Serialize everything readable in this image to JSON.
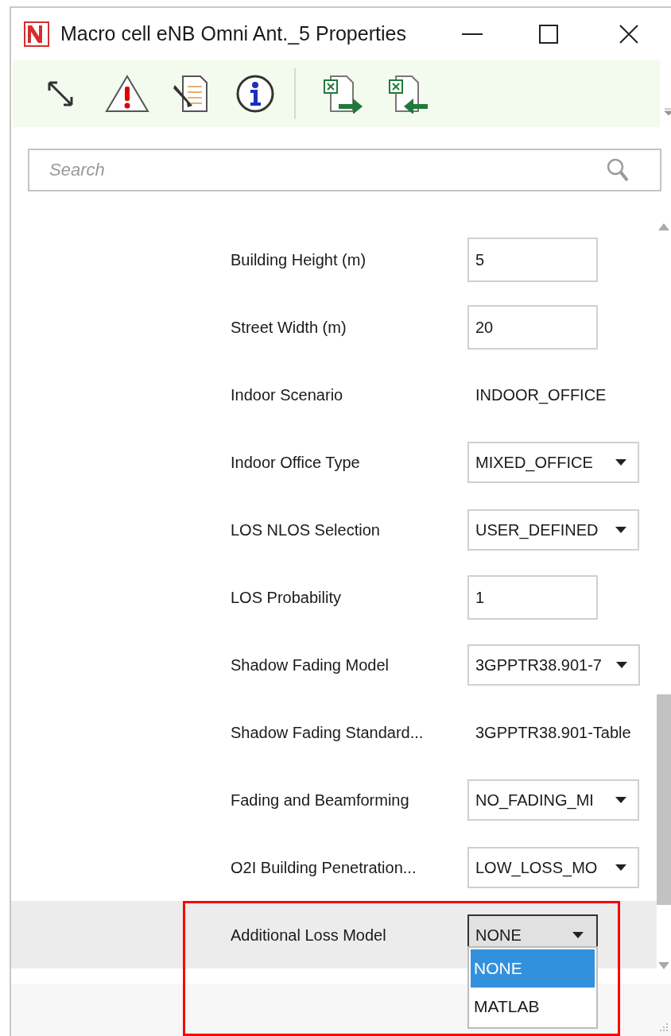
{
  "window": {
    "title": "Macro cell eNB Omni Ant._5 Properties"
  },
  "search": {
    "placeholder": "Search"
  },
  "properties": [
    {
      "label": "Building Height (m)",
      "kind": "input",
      "value": "5"
    },
    {
      "label": "Street Width (m)",
      "kind": "input",
      "value": "20"
    },
    {
      "label": "Indoor Scenario",
      "kind": "text",
      "value": "INDOOR_OFFICE"
    },
    {
      "label": "Indoor Office Type",
      "kind": "dropdown",
      "value": "MIXED_OFFICE"
    },
    {
      "label": "LOS NLOS Selection",
      "kind": "dropdown",
      "value": "USER_DEFINED"
    },
    {
      "label": "LOS Probability",
      "kind": "input",
      "value": "1"
    },
    {
      "label": "Shadow Fading Model",
      "kind": "dropdown",
      "value": "3GPPTR38.901-7"
    },
    {
      "label": "Shadow Fading Standard...",
      "kind": "text",
      "value": "3GPPTR38.901-Table"
    },
    {
      "label": "Fading and Beamforming",
      "kind": "dropdown",
      "value": "NO_FADING_MI"
    },
    {
      "label": "O2I Building Penetration...",
      "kind": "dropdown",
      "value": "LOW_LOSS_MO"
    },
    {
      "label": "Additional Loss Model",
      "kind": "dropdown",
      "value": "NONE",
      "active": true,
      "highlighted": true,
      "outlined": true,
      "options": [
        {
          "label": "NONE",
          "selected": true
        },
        {
          "label": "MATLAB",
          "selected": false
        }
      ]
    }
  ]
}
